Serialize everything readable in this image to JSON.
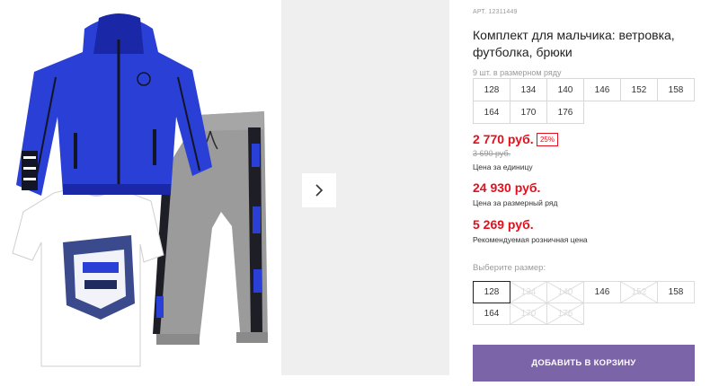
{
  "product": {
    "article": "АРТ. 12311449",
    "title": "Комплект для мальчика: ветровка, футболка, брюки",
    "pieces_per_row": "9 шт. в размерном ряду",
    "row_sizes": [
      "128",
      "134",
      "140",
      "146",
      "152",
      "158",
      "164",
      "170",
      "176"
    ]
  },
  "prices": {
    "unit": "2 770 руб.",
    "discount": "25%",
    "old": "3 690 руб.",
    "unit_label": "Цена за единицу",
    "row": "24 930 руб.",
    "row_label": "Цена за размерный ряд",
    "retail": "5 269 руб.",
    "retail_label": "Рекомендуемая розничная цена"
  },
  "size_picker": {
    "label": "Выберите размер:",
    "sizes": [
      {
        "label": "128",
        "state": "selected"
      },
      {
        "label": "134",
        "state": "disabled"
      },
      {
        "label": "140",
        "state": "disabled"
      },
      {
        "label": "146",
        "state": "available"
      },
      {
        "label": "152",
        "state": "disabled"
      },
      {
        "label": "158",
        "state": "available"
      },
      {
        "label": "164",
        "state": "available"
      },
      {
        "label": "170",
        "state": "disabled"
      },
      {
        "label": "176",
        "state": "disabled"
      }
    ]
  },
  "cart": {
    "add_label": "ДОБАВИТЬ В КОРЗИНУ"
  },
  "colors": {
    "price": "#e0101d",
    "button": "#7c64a9",
    "jacket": "#2a3fd6",
    "tshirt": "#ffffff",
    "pants": "#9b9b9b"
  },
  "gallery": {
    "images": [
      "product-photo",
      "product-photo-next"
    ],
    "next_icon": "chevron-right-icon"
  }
}
